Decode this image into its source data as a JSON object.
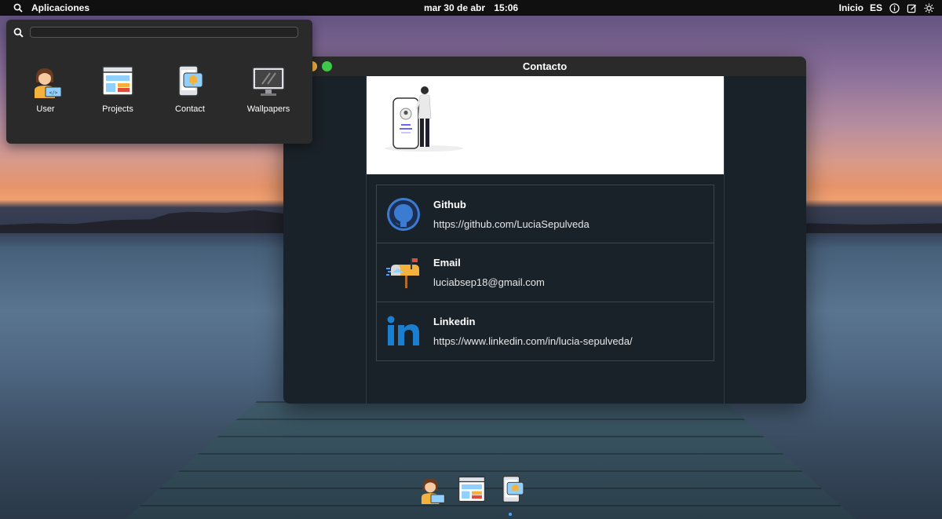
{
  "topbar": {
    "apps_label": "Aplicaciones",
    "date": "mar 30 de abr",
    "time": "15:06",
    "home_label": "Inicio",
    "lang_label": "ES"
  },
  "launcher": {
    "search_placeholder": "",
    "apps": [
      {
        "label": "User",
        "icon": "user-developer-icon"
      },
      {
        "label": "Projects",
        "icon": "browser-window-icon"
      },
      {
        "label": "Contact",
        "icon": "phone-notification-icon"
      },
      {
        "label": "Wallpapers",
        "icon": "monitor-icon"
      }
    ]
  },
  "window": {
    "title": "Contacto",
    "contacts": [
      {
        "title": "Github",
        "value": "https://github.com/LuciaSepulveda",
        "icon": "github-icon"
      },
      {
        "title": "Email",
        "value": "luciabsep18@gmail.com",
        "icon": "mailbox-icon"
      },
      {
        "title": "Linkedin",
        "value": "https://www.linkedin.com/in/lucia-sepulveda/",
        "icon": "linkedin-icon"
      }
    ]
  },
  "dock": {
    "items": [
      "user-developer-icon",
      "browser-window-icon",
      "phone-notification-icon"
    ]
  },
  "colors": {
    "topbar_bg": "#101010",
    "panel_bg": "#2a2a2a",
    "window_bg": "#1a2229",
    "traffic_yellow": "#f5b942",
    "traffic_green": "#3ec94a",
    "dock_indicator": "#4aa3ff"
  }
}
